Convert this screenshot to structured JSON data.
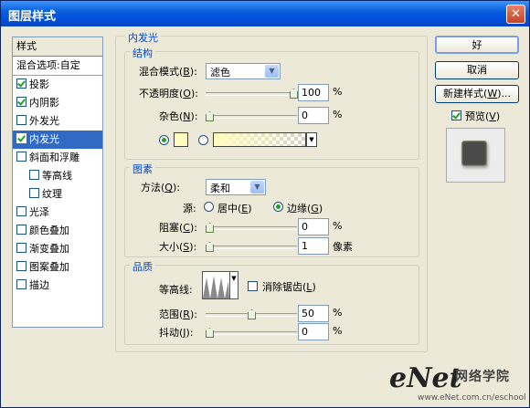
{
  "window": {
    "title": "图层样式",
    "close_glyph": "✕"
  },
  "style_list": {
    "header": "样式",
    "items": [
      {
        "label": "混合选项:自定",
        "checkbox": false,
        "checked": false,
        "indent": false,
        "selected": false
      },
      {
        "label": "投影",
        "checkbox": true,
        "checked": true,
        "indent": false,
        "selected": false
      },
      {
        "label": "内阴影",
        "checkbox": true,
        "checked": true,
        "indent": false,
        "selected": false
      },
      {
        "label": "外发光",
        "checkbox": true,
        "checked": false,
        "indent": false,
        "selected": false
      },
      {
        "label": "内发光",
        "checkbox": true,
        "checked": true,
        "indent": false,
        "selected": true
      },
      {
        "label": "斜面和浮雕",
        "checkbox": true,
        "checked": false,
        "indent": false,
        "selected": false
      },
      {
        "label": "等高线",
        "checkbox": true,
        "checked": false,
        "indent": true,
        "selected": false
      },
      {
        "label": "纹理",
        "checkbox": true,
        "checked": false,
        "indent": true,
        "selected": false
      },
      {
        "label": "光泽",
        "checkbox": true,
        "checked": false,
        "indent": false,
        "selected": false
      },
      {
        "label": "颜色叠加",
        "checkbox": true,
        "checked": false,
        "indent": false,
        "selected": false
      },
      {
        "label": "渐变叠加",
        "checkbox": true,
        "checked": false,
        "indent": false,
        "selected": false
      },
      {
        "label": "图案叠加",
        "checkbox": true,
        "checked": false,
        "indent": false,
        "selected": false
      },
      {
        "label": "描边",
        "checkbox": true,
        "checked": false,
        "indent": false,
        "selected": false
      }
    ]
  },
  "inner_glow": {
    "title": "内发光",
    "structure": {
      "title": "结构",
      "blend_mode_label": "混合模式(",
      "blend_mode_key": "B",
      "blend_mode_value": "滤色",
      "opacity_label": "不透明度(",
      "opacity_key": "O",
      "opacity_value": "100",
      "opacity_level": 1.0,
      "noise_label": "杂色(",
      "noise_key": "N",
      "noise_value": "0",
      "noise_level": 0.0,
      "percent": "%",
      "glow_color": "#fffcc0",
      "gradient_from": "#fffcc0",
      "use_color": true
    },
    "elements": {
      "title": "图素",
      "technique_label": "方法(",
      "technique_key": "Q",
      "technique_value": "柔和",
      "source_label": "源:",
      "center_label": "居中(",
      "center_key": "E",
      "edge_label": "边缘(",
      "edge_key": "G",
      "source_selected": "edge",
      "choke_label": "阻塞(",
      "choke_key": "C",
      "choke_value": "0",
      "choke_level": 0.0,
      "size_label": "大小(",
      "size_key": "S",
      "size_value": "1",
      "size_level": 0.0,
      "percent": "%",
      "size_unit": "像素"
    },
    "quality": {
      "title": "品质",
      "contour_label": "等高线:",
      "anti_alias_label": "消除锯齿(",
      "anti_alias_key": "L",
      "anti_alias_checked": false,
      "range_label": "范围(",
      "range_key": "R",
      "range_value": "50",
      "range_level": 0.5,
      "jitter_label": "抖动(",
      "jitter_key": "J",
      "jitter_value": "0",
      "jitter_level": 0.0,
      "percent": "%"
    }
  },
  "buttons": {
    "ok": "好",
    "cancel": "取消",
    "new_style_prefix": "新建样式(",
    "new_style_key": "W",
    "new_style_suffix": ")...",
    "preview_label": "预览(",
    "preview_key": "V",
    "preview_checked": true
  },
  "close_paren": ")",
  "close_paren_colon": "):",
  "preview_swatch_color": "#4a4a4a",
  "watermark": {
    "brand": "eNet",
    "site": "网络学院",
    "url": "www.eNet.com.cn/eschool"
  }
}
